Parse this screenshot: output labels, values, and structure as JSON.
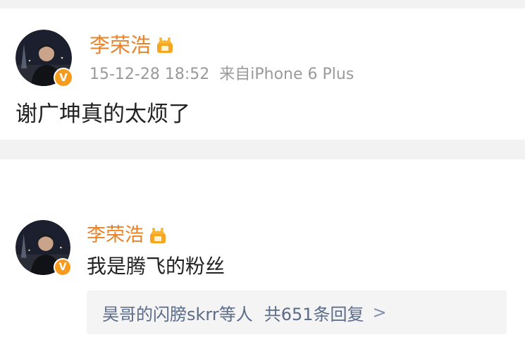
{
  "post": {
    "username": "李荣浩",
    "timestamp": "15-12-28 18:52",
    "source": "来自iPhone 6 Plus",
    "text": "谢广坤真的太烦了"
  },
  "comment": {
    "username": "李荣浩",
    "text": "我是腾飞的粉丝",
    "replies_from": "昊哥的闪膀skrr等人",
    "replies_count": "共651条回复",
    "replies_chevron": ">"
  },
  "badge": {
    "label": "V"
  },
  "colors": {
    "username": "#e8832a",
    "badge": "#f79b1c",
    "reply_link": "#5b6b8a",
    "separator": "#f2f2f2"
  },
  "icons": [
    "avatar-photo",
    "verified-badge-icon",
    "crown-icon",
    "chevron-right-icon"
  ]
}
